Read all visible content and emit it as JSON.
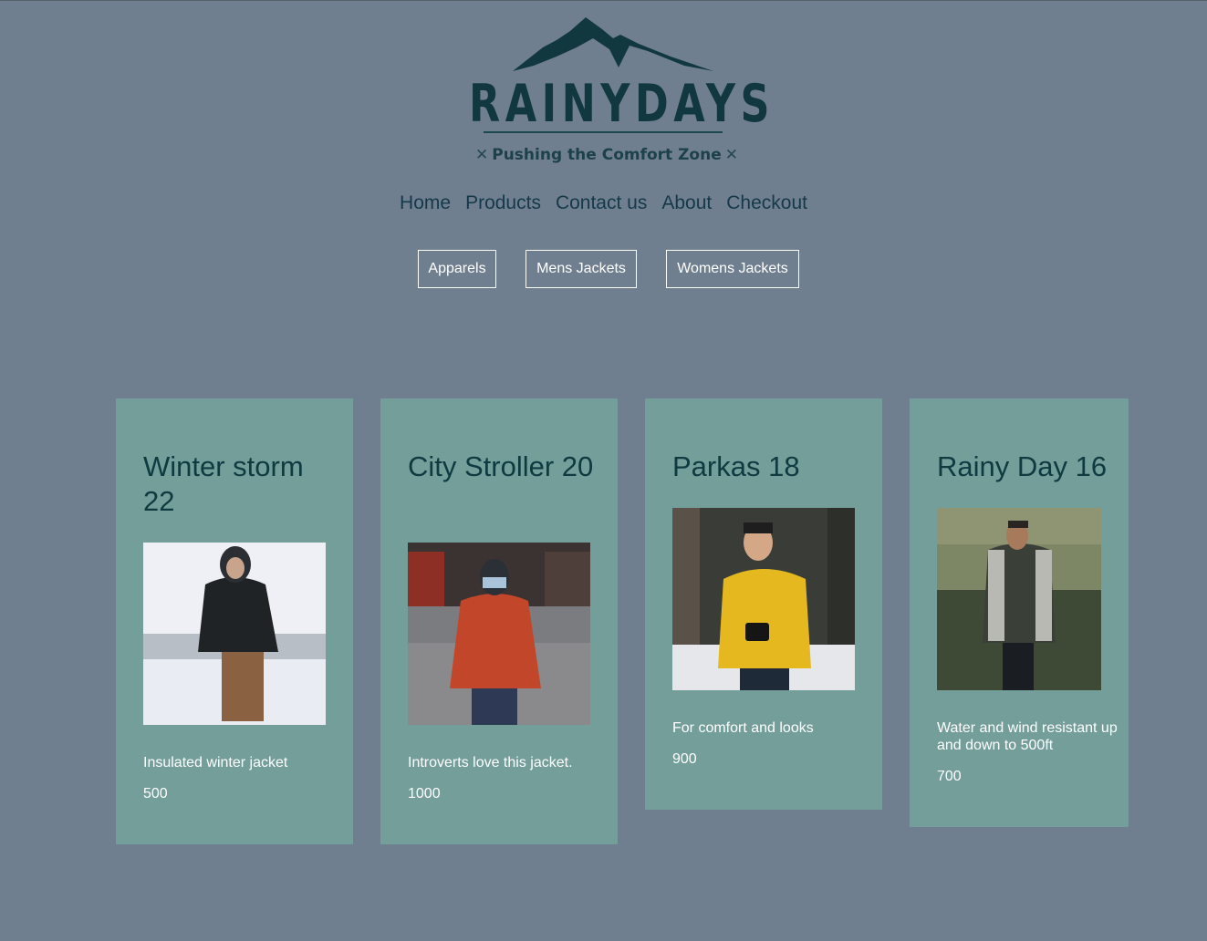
{
  "brand": {
    "name": "RAINYDAYS",
    "tagline": "Pushing the Comfort Zone",
    "tagline_mark": "✕",
    "logo_color": "#12383f"
  },
  "nav": {
    "items": [
      "Home",
      "Products",
      "Contact us",
      "About",
      "Checkout"
    ]
  },
  "filters": {
    "items": [
      "Apparels",
      "Mens Jackets",
      "Womens Jackets"
    ]
  },
  "products": [
    {
      "title": "Winter storm 22",
      "description": "Insulated winter jacket",
      "price": "500",
      "image_icon": "person-black-jacket-snow-photo"
    },
    {
      "title": "City Stroller 20",
      "description": "Introverts love this jacket.",
      "price": "1000",
      "image_icon": "person-orange-jacket-street-photo"
    },
    {
      "title": "Parkas 18",
      "description": "For comfort and looks",
      "price": "900",
      "image_icon": "person-yellow-jacket-forest-photo"
    },
    {
      "title": "Rainy Day 16",
      "description": "Water and wind resistant up and down to 500ft",
      "price": "700",
      "image_icon": "person-grey-jacket-field-photo"
    }
  ],
  "colors": {
    "page_bg": "#6f7f8f",
    "card_bg": "#739e9a",
    "heading": "#0e3a40",
    "nav_text": "#15394a"
  }
}
